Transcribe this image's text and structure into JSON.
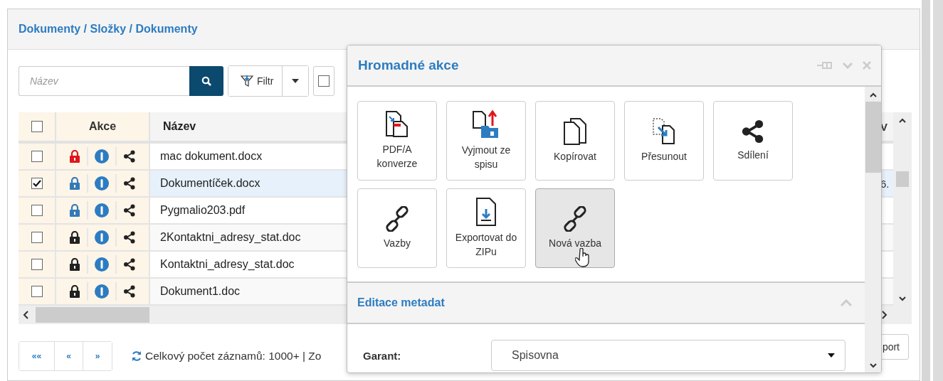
{
  "breadcrumb": "Dokumenty / Složky / Dokumenty",
  "toolbar": {
    "search": {
      "placeholder": "Název"
    },
    "filter_button": "Filtr",
    "checkbox": {
      "checked": false
    }
  },
  "table": {
    "header_checkbox": {
      "checked": false
    },
    "columns": [
      "Akce",
      "Název",
      "V"
    ],
    "rows": [
      {
        "checked": false,
        "selected": false,
        "color": "#e0161e",
        "name": "mac dokument.docx"
      },
      {
        "checked": true,
        "selected": true,
        "color": "#337ab7",
        "name": "Dokumentíček.docx",
        "column_3": "6."
      },
      {
        "checked": false,
        "selected": false,
        "color": "#337ab7",
        "name": "Pygmalio203.pdf"
      },
      {
        "checked": false,
        "selected": false,
        "color": "#222222",
        "name": "2Kontaktni_adresy_stat.doc"
      },
      {
        "checked": false,
        "selected": false,
        "color": "#222222",
        "name": "Kontaktni_adresy_stat.doc"
      },
      {
        "checked": false,
        "selected": false,
        "color": "#222222",
        "name": "Dokument1.doc"
      }
    ]
  },
  "pager": {
    "buttons": [
      "««",
      "«",
      "»"
    ],
    "status": "Celkový počet záznamů: 1000+ | Zo",
    "export_button": "port"
  },
  "popup": {
    "title": "Hromadné akce",
    "tiles": [
      {
        "kind": "pdf",
        "label": "PDF/A konverze",
        "hovered": false
      },
      {
        "kind": "remove",
        "label": "Vyjmout ze spisu",
        "hovered": false
      },
      {
        "kind": "copy",
        "label": "Kopírovat",
        "hovered": false
      },
      {
        "kind": "move",
        "label": "Přesunout",
        "hovered": false
      },
      {
        "kind": "share",
        "label": "Sdílení",
        "hovered": false
      },
      {
        "kind": "link",
        "label": "Vazby",
        "hovered": false
      },
      {
        "kind": "export",
        "label": "Exportovat do ZIPu",
        "hovered": false
      },
      {
        "kind": "link",
        "label": "Nová vazba",
        "hovered": true
      }
    ],
    "section": {
      "title": "Editace metadat",
      "expanded": true,
      "fields": [
        {
          "label": "Garant:",
          "value": "Spisovna"
        }
      ]
    }
  }
}
